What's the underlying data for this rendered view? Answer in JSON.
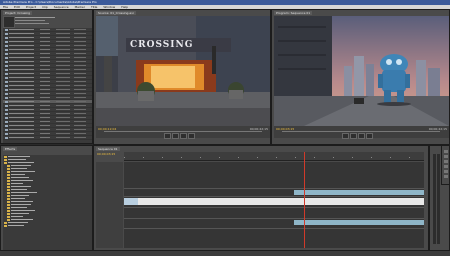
{
  "window": {
    "title": "Adobe Premiere Pro - C:\\Users\\Documents\\Adobe\\Premiere Pro"
  },
  "menu": [
    "File",
    "Edit",
    "Project",
    "Clip",
    "Sequence",
    "Marker",
    "Title",
    "Window",
    "Help"
  ],
  "project": {
    "tab": "Project: Crossing"
  },
  "source": {
    "tab": "Source: 01_Crossing.avi",
    "timecode_in": "00;00;12;04",
    "timecode_out": "00;00;22;15",
    "sign_text": "CROSSING"
  },
  "program": {
    "tab": "Program: Sequence 01",
    "timecode_in": "00;00;03;15",
    "timecode_out": "00;00;22;15"
  },
  "effects": {
    "tab": "Effects"
  },
  "timeline": {
    "tab": "Sequence 01",
    "timecode": "00;00;03;15"
  },
  "colors": {
    "accent": "#f0c040",
    "clip_video": "#8fb6c8",
    "clip_selected": "#e8e8e8",
    "playhead": "#d03a2a"
  }
}
